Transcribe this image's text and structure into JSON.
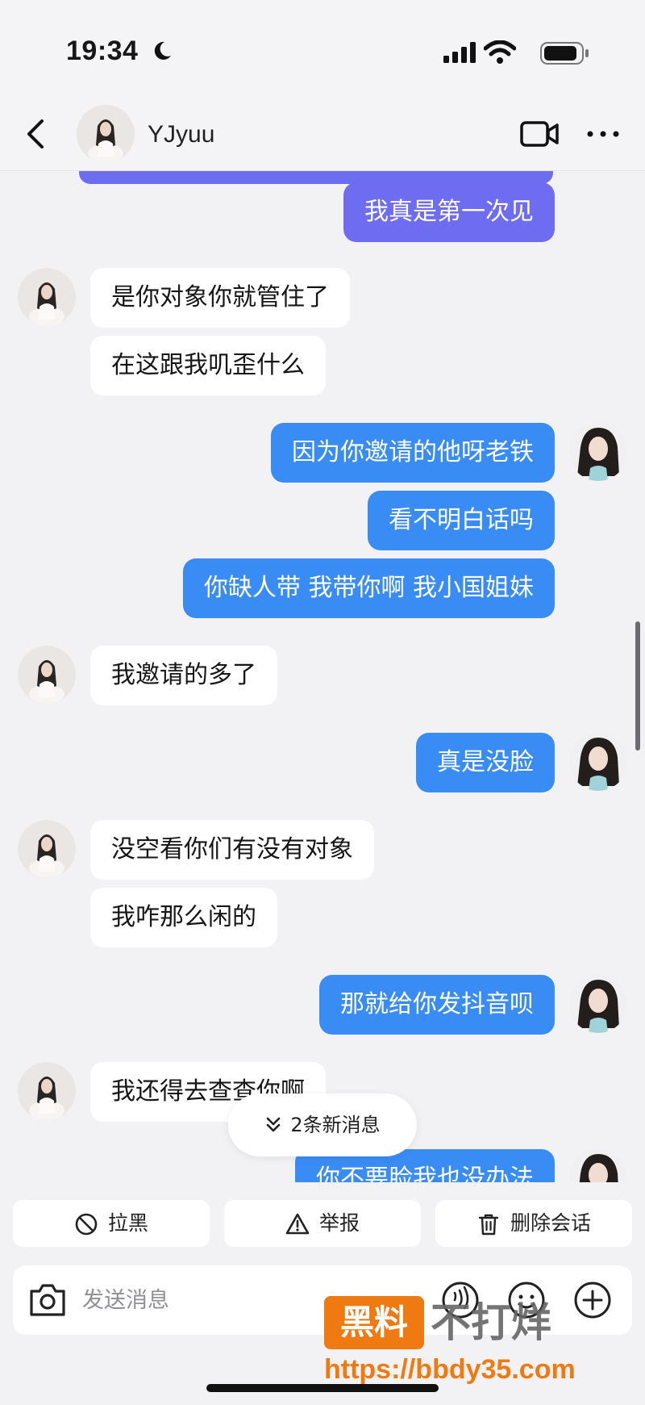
{
  "status_bar": {
    "time": "19:34"
  },
  "header": {
    "contact_name": "YJyuu"
  },
  "messages": [
    {
      "side": "out",
      "text": "我真是第一次见"
    },
    {
      "side": "in",
      "text": "是你对象你就管住了"
    },
    {
      "side": "in",
      "text": "在这跟我叽歪什么"
    },
    {
      "side": "out",
      "text": "因为你邀请的他呀老铁"
    },
    {
      "side": "out",
      "text": "看不明白话吗"
    },
    {
      "side": "out",
      "text": "你缺人带 我带你啊 我小国姐妹"
    },
    {
      "side": "in",
      "text": "我邀请的多了"
    },
    {
      "side": "out",
      "text": "真是没脸"
    },
    {
      "side": "in",
      "text": "没空看你们有没有对象"
    },
    {
      "side": "in",
      "text": "我咋那么闲的"
    },
    {
      "side": "out",
      "text": "那就给你发抖音呗"
    },
    {
      "side": "in",
      "text": "我还得去查查你啊"
    },
    {
      "side": "out",
      "text": "你不要脸我也没办法"
    }
  ],
  "new_messages_pill": "2条新消息",
  "actions": {
    "block": "拉黑",
    "report": "举报",
    "delete_chat": "删除会话"
  },
  "input": {
    "placeholder": "发送消息"
  },
  "watermark": {
    "logo": "黑料",
    "brand": "不打烊",
    "url": "https://bbdy35.com"
  },
  "colors": {
    "outgoing_blue": "#3a8cf5",
    "outgoing_purple": "#6e6cf1",
    "incoming": "#ffffff",
    "background": "#f2f2f4"
  }
}
